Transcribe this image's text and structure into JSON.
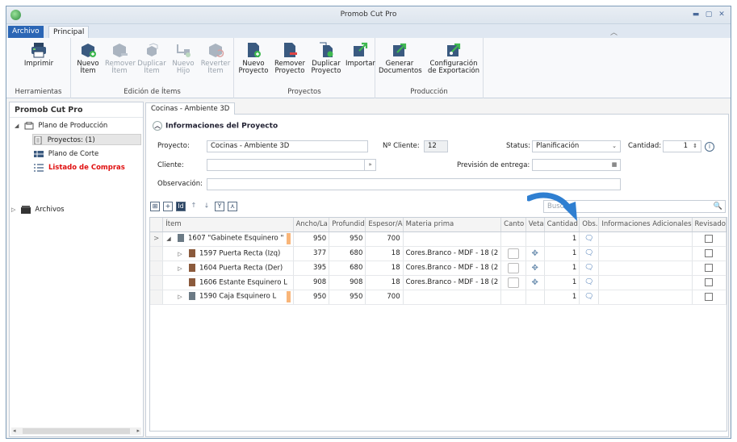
{
  "window": {
    "title": "Promob Cut Pro"
  },
  "ribbon_tabs": {
    "file": "Archivo",
    "main": "Principal"
  },
  "ribbon": {
    "groups": [
      {
        "label": "Herramientas",
        "buttons": [
          {
            "label": "Imprimir",
            "icon": "printer-icon",
            "enabled": true
          }
        ]
      },
      {
        "label": "Edición de Ítems",
        "buttons": [
          {
            "label": "Nuevo Ítem",
            "icon": "new-item-icon",
            "enabled": true
          },
          {
            "label": "Remover Ítem",
            "icon": "remove-item-icon",
            "enabled": false
          },
          {
            "label": "Duplicar Ítem",
            "icon": "duplicate-item-icon",
            "enabled": false
          },
          {
            "label": "Nuevo Hijo",
            "icon": "new-child-icon",
            "enabled": false
          },
          {
            "label": "Reverter Ítem",
            "icon": "revert-item-icon",
            "enabled": false
          }
        ]
      },
      {
        "label": "Proyectos",
        "buttons": [
          {
            "label": "Nuevo Proyecto",
            "icon": "new-project-icon",
            "enabled": true
          },
          {
            "label": "Remover Proyecto",
            "icon": "remove-project-icon",
            "enabled": true
          },
          {
            "label": "Duplicar Proyecto",
            "icon": "duplicate-project-icon",
            "enabled": true
          },
          {
            "label": "Importar",
            "icon": "import-icon",
            "enabled": true
          }
        ]
      },
      {
        "label": "Producción",
        "buttons": [
          {
            "label": "Generar Documentos",
            "icon": "generate-documents-icon",
            "enabled": true
          },
          {
            "label": "Configuración de Exportación",
            "icon": "export-config-icon",
            "enabled": true
          }
        ]
      }
    ]
  },
  "left_panel": {
    "title": "Promob Cut Pro",
    "tree": [
      {
        "label": "Plano de Producción",
        "level": 0,
        "expanded": true
      },
      {
        "label": "Proyectos: (1)",
        "level": 1,
        "selected": true
      },
      {
        "label": "Plano de Corte",
        "level": 1
      },
      {
        "label": "Listado de Compras",
        "level": 1,
        "highlight": true
      },
      {
        "label": "Archivos",
        "level": 0,
        "expanded": false
      }
    ]
  },
  "doc_tab": "Cocinas - Ambiente 3D",
  "project_info": {
    "section_title": "Informaciones del Proyecto",
    "proyecto_label": "Proyecto:",
    "proyecto_value": "Cocinas - Ambiente 3D",
    "nro_cliente_label": "Nº Cliente:",
    "nro_cliente_value": "12",
    "status_label": "Status:",
    "status_value": "Planificación",
    "cantidad_label": "Cantidad:",
    "cantidad_value": "1",
    "cliente_label": "Cliente:",
    "cliente_value": "",
    "prevision_label": "Previsión de entrega:",
    "prevision_value": "",
    "observacion_label": "Observación:",
    "observacion_value": ""
  },
  "grid_toolbar": {
    "search_placeholder": "Buscar",
    "tools": [
      "expand-all-icon",
      "collapse-all-icon",
      "id-icon",
      "move-up-icon",
      "move-down-icon",
      "filter-icon",
      "hierarchy-icon"
    ]
  },
  "grid": {
    "columns": [
      "Ítem",
      "Ancho/La",
      "Profundid",
      "Espesor/A",
      "Materia prima",
      "Canto",
      "Veta",
      "Cantidad",
      "Obs.",
      "Informaciones Adicionales",
      "Revisado"
    ],
    "rows": [
      {
        "indent": 0,
        "expand": "◢",
        "item": "1607 \"Gabinete Esquinero \"",
        "ancho": "950",
        "prof": "950",
        "esp": "700",
        "materia": "",
        "canto": false,
        "veta": false,
        "cantidad": "1",
        "current": true
      },
      {
        "indent": 1,
        "expand": "▷",
        "item": "1597 Puerta Recta (Izq)",
        "ancho": "377",
        "prof": "680",
        "esp": "18",
        "materia": "Cores.Branco - MDF - 18 (2",
        "canto": true,
        "veta": true,
        "cantidad": "1"
      },
      {
        "indent": 1,
        "expand": "▷",
        "item": "1604 Puerta Recta (Der)",
        "ancho": "395",
        "prof": "680",
        "esp": "18",
        "materia": "Cores.Branco - MDF - 18 (2",
        "canto": true,
        "veta": true,
        "cantidad": "1"
      },
      {
        "indent": 1,
        "expand": "",
        "item": "1606 Estante Esquinero L",
        "ancho": "908",
        "prof": "908",
        "esp": "18",
        "materia": "Cores.Branco - MDF - 18 (2",
        "canto": true,
        "veta": true,
        "cantidad": "1"
      },
      {
        "indent": 1,
        "expand": "▷",
        "item": "1590 Caja Esquinero L",
        "ancho": "950",
        "prof": "950",
        "esp": "700",
        "materia": "",
        "canto": false,
        "veta": false,
        "cantidad": "1"
      }
    ]
  },
  "colors": {
    "accent": "#2b66b5",
    "highlight_red": "#e01010",
    "orange_tag": "#f8b579",
    "arrow_blue": "#2f7fd1"
  }
}
